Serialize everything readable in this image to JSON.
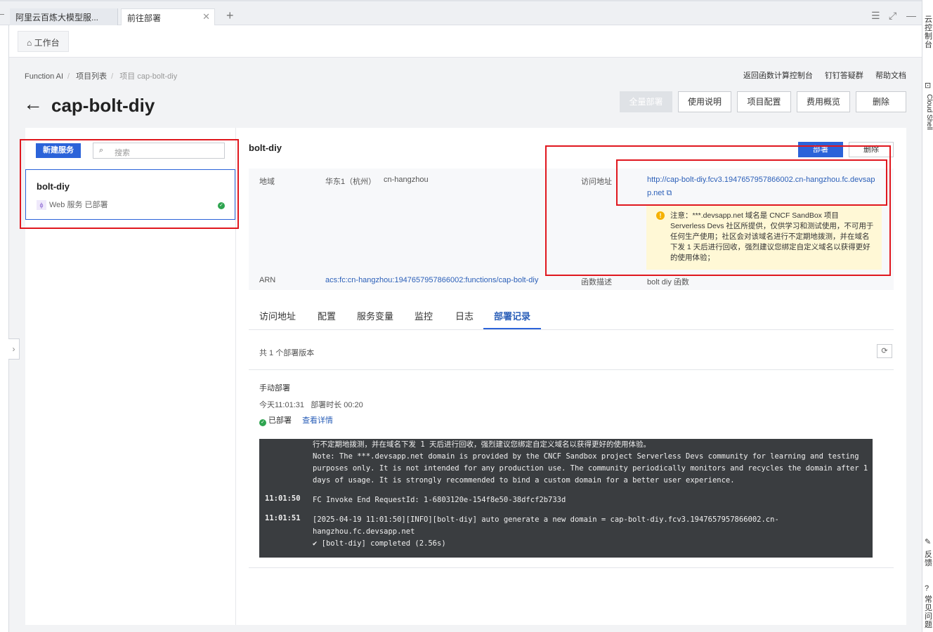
{
  "browser": {
    "tabs": [
      {
        "label": "阿里云百炼大模型服..."
      },
      {
        "label": "前往部署"
      }
    ],
    "close_glyph": "✕",
    "add_glyph": "+"
  },
  "workbench": {
    "label": "工作台"
  },
  "breadcrumb": [
    "Function AI",
    "项目列表",
    "项目 cap-bolt-diy"
  ],
  "top_links": [
    "返回函数计算控制台",
    "钉钉答疑群",
    "帮助文档"
  ],
  "page": {
    "title": "cap-bolt-diy"
  },
  "header_buttons": [
    "全量部署",
    "使用说明",
    "项目配置",
    "费用概览",
    "删除"
  ],
  "sidebar": {
    "new_button": "新建服务",
    "search_placeholder": "搜索",
    "service": {
      "name": "bolt-diy",
      "type": "Web 服务",
      "status": "已部署"
    }
  },
  "service_panel": {
    "title": "bolt-diy",
    "deploy_button": "部署",
    "delete_button": "删除",
    "region_label": "地域",
    "region_value": "华东1（杭州）",
    "region_code": "cn-hangzhou",
    "access_label": "访问地址",
    "access_url_line1": "http://cap-bolt-diy.fcv3.1947657957866002.cn-hangzhou.fc.devsap",
    "access_url_line2": "p.net",
    "warning": "注意：***.devsapp.net 域名是 CNCF SandBox 项目 Serverless Devs 社区所提供，仅供学习和测试使用，不可用于任何生产使用；社区会对该域名进行不定期地拨测，并在域名下发 1 天后进行回收，强烈建议您绑定自定义域名以获得更好的使用体验；",
    "arn_label": "ARN",
    "arn_value": "acs:fc:cn-hangzhou:1947657957866002:functions/cap-bolt-diy",
    "desc_label": "函数描述",
    "desc_value": "bolt diy 函数"
  },
  "tabs": [
    "访问地址",
    "配置",
    "服务变量",
    "监控",
    "日志",
    "部署记录"
  ],
  "active_tab": "部署记录",
  "deploy_records": {
    "count_text": "共 1 个部署版本",
    "record": {
      "title": "手动部署",
      "time": "今天11:01:31",
      "duration": "部署时长 00:20",
      "status": "已部署",
      "detail_link": "查看详情"
    }
  },
  "log": {
    "lines": [
      {
        "ts": "",
        "text": "行不定期地拨测，并在域名下发 1 天后进行回收，强烈建议您绑定自定义域名以获得更好的使用体验。"
      },
      {
        "ts": "",
        "text": "Note: The ***.devsapp.net domain is provided by the CNCF Sandbox project Serverless Devs community for learning and testing"
      },
      {
        "ts": "",
        "text": "purposes only. It is not intended for any production use. The community periodically monitors and recycles the domain after 1"
      },
      {
        "ts": "",
        "text": "days of usage. It is strongly recommended to bind a custom domain for a better user experience."
      },
      {
        "ts": "11:01:50",
        "text": "FC Invoke End RequestId: 1-6803120e-154f8e50-38dfcf2b733d"
      },
      {
        "ts": "11:01:51",
        "text": "[2025-04-19 11:01:50][INFO][bolt-diy] auto generate a new domain = cap-bolt-diy.fcv3.1947657957866002.cn-"
      },
      {
        "ts": "",
        "text": "hangzhou.fc.devsapp.net"
      },
      {
        "ts": "",
        "text": "✔ [bolt-diy] completed (2.56s)"
      }
    ]
  },
  "right_rail": {
    "items": [
      "云控制台",
      "Cloud Shell",
      "反馈",
      "常见问题"
    ]
  },
  "colors": {
    "primary": "#2b63d9",
    "annotation_red": "#e0171e",
    "success": "#2ea44f",
    "warning_bg": "#fff8d6"
  }
}
